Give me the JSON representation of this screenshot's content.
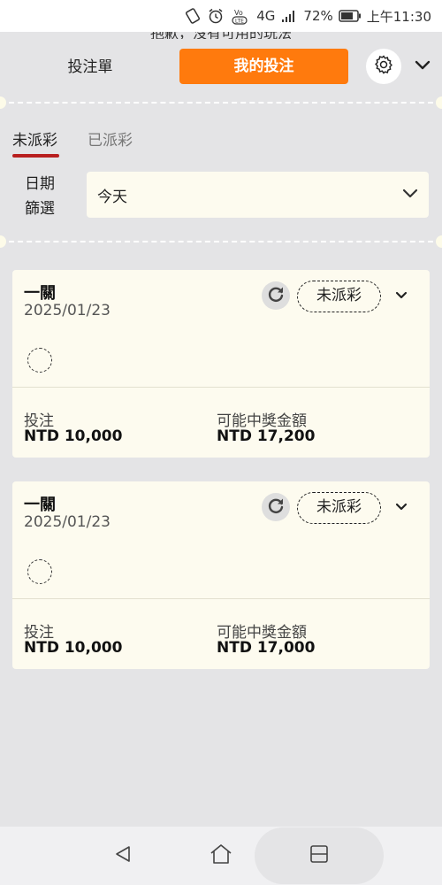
{
  "status_bar": {
    "network": "4G",
    "battery": "72%",
    "time": "上午11:30",
    "volte_label": "VoLTE"
  },
  "underlay_text": "抱歉，沒有可用的玩法",
  "header": {
    "tab_betslip": "投注單",
    "tab_mybets": "我的投注",
    "accent_color": "#ff7a0d"
  },
  "subtabs": [
    {
      "label": "未派彩",
      "active": true
    },
    {
      "label": "已派彩",
      "active": false
    }
  ],
  "date_filter": {
    "label": "日期篩選",
    "value": "今天"
  },
  "bets": [
    {
      "title": "一關",
      "date": "2025/01/23",
      "status": "未派彩",
      "stake_label": "投注",
      "stake_value": "NTD 10,000",
      "win_label": "可能中獎金額",
      "win_value": "NTD 17,200"
    },
    {
      "title": "一關",
      "date": "2025/01/23",
      "status": "未派彩",
      "stake_label": "投注",
      "stake_value": "NTD 10,000",
      "win_label": "可能中獎金額",
      "win_value": "NTD 17,000"
    }
  ],
  "icons": {
    "settings": "gear-icon",
    "collapse": "chevron-down-icon",
    "refresh": "refresh-icon",
    "expand": "chevron-down-icon",
    "loading": "loading-circle-icon",
    "nav_back": "back-triangle-icon",
    "nav_home": "home-icon",
    "nav_recent": "recent-apps-icon"
  }
}
